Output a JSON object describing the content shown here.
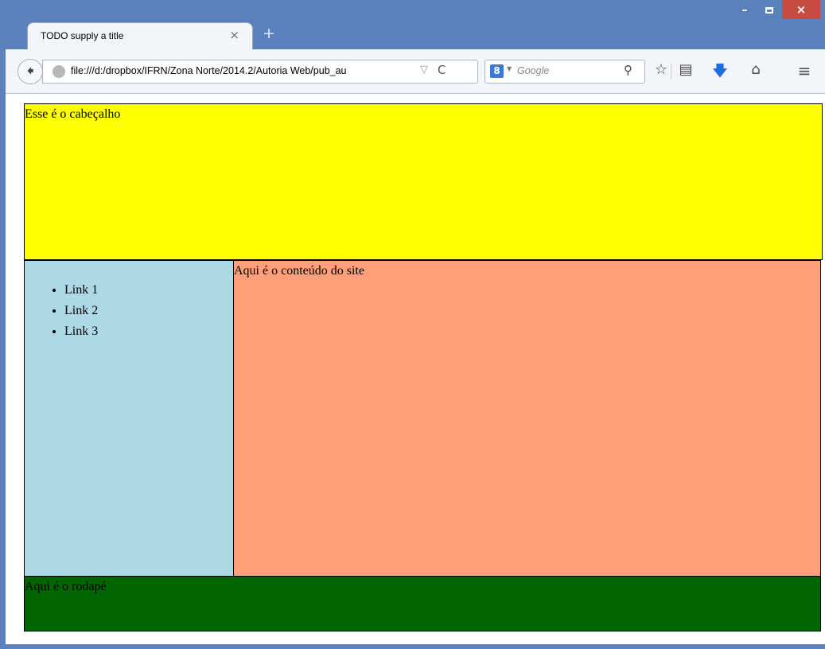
{
  "browser": {
    "tab_title": "TODO supply a title",
    "tab_close": "×",
    "new_tab": "+",
    "url": "file:///d:/dropbox/IFRN/Zona Norte/2014.2/Autoria Web/pub_au",
    "search_placeholder": "Google",
    "search_engine_badge": "8",
    "window": {
      "min": "–",
      "close": "×"
    }
  },
  "page": {
    "header_text": "Esse é o cabeçalho",
    "content_text": "Aqui é o conteúdo do site",
    "footer_text": "Aqui é o rodapé",
    "links": [
      "Link 1",
      "Link 2",
      "Link 3"
    ]
  },
  "colors": {
    "header": "#ffff00",
    "sidebar": "#add8e6",
    "content": "#ffa07a",
    "footer": "#006400"
  }
}
